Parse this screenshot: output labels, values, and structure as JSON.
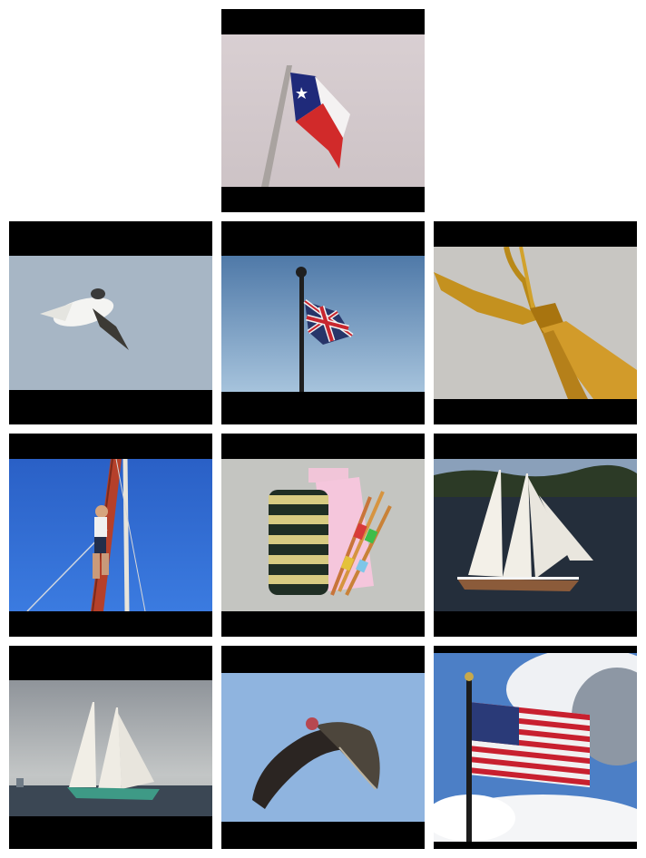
{
  "grid": {
    "rows": 4,
    "columns": 3,
    "tiles": [
      {
        "row": 1,
        "col": 2,
        "subject": "texas-flag-on-pole"
      },
      {
        "row": 2,
        "col": 1,
        "subject": "white-bird-in-flight"
      },
      {
        "row": 2,
        "col": 2,
        "subject": "union-jack-flag-on-pole"
      },
      {
        "row": 2,
        "col": 3,
        "subject": "gold-necktie"
      },
      {
        "row": 3,
        "col": 1,
        "subject": "person-climbing-ship-mast"
      },
      {
        "row": 3,
        "col": 2,
        "subject": "knitted-pouch-and-pens"
      },
      {
        "row": 3,
        "col": 3,
        "subject": "model-sailboat-on-water"
      },
      {
        "row": 4,
        "col": 1,
        "subject": "schooner-sailing-at-sea"
      },
      {
        "row": 4,
        "col": 2,
        "subject": "vulture-in-flight"
      },
      {
        "row": 4,
        "col": 3,
        "subject": "american-flag-and-clouds"
      }
    ]
  },
  "colors": {
    "page_background": "#ffffff",
    "letterbox": "#000000",
    "overcast_sky": "#d7cdd0",
    "blue_sky": "#8fb1d6",
    "deep_blue_sky": "#2f6fd0",
    "water": "#223040"
  }
}
